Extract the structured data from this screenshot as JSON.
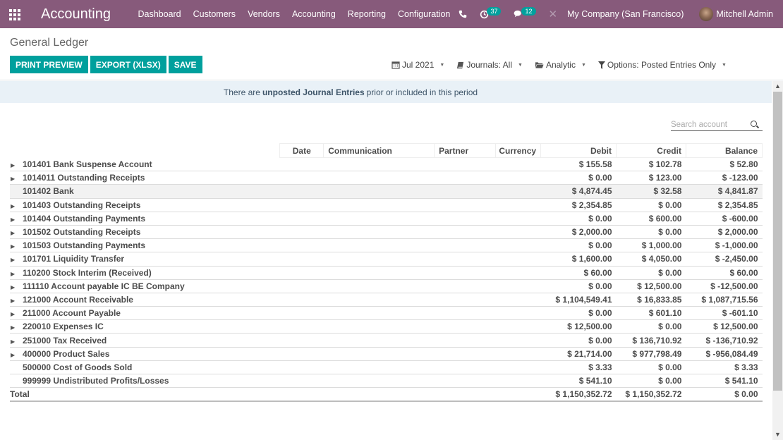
{
  "navbar": {
    "app_title": "Accounting",
    "menu": [
      "Dashboard",
      "Customers",
      "Vendors",
      "Accounting",
      "Reporting",
      "Configuration"
    ],
    "activity_count": "37",
    "messages_count": "12",
    "company": "My Company (San Francisco)",
    "user": "Mitchell Admin"
  },
  "control_panel": {
    "title": "General Ledger",
    "buttons": {
      "print_preview": "PRINT PREVIEW",
      "export": "EXPORT (XLSX)",
      "save": "SAVE"
    },
    "filters": {
      "date": "Jul 2021",
      "journals": "Journals: All",
      "analytic": "Analytic",
      "options": "Options: Posted Entries Only"
    }
  },
  "alert": {
    "prefix": "There are",
    "bold": "unposted Journal Entries",
    "suffix": "prior or included in this period"
  },
  "search": {
    "placeholder": "Search account"
  },
  "table": {
    "headers": [
      "Date",
      "Communication",
      "Partner",
      "Currency",
      "Debit",
      "Credit",
      "Balance"
    ],
    "rows": [
      {
        "expandable": true,
        "account": "101401 Bank Suspense Account",
        "debit": "$ 155.58",
        "credit": "$ 102.78",
        "balance": "$ 52.80"
      },
      {
        "expandable": true,
        "account": "1014011 Outstanding Receipts",
        "debit": "$ 0.00",
        "credit": "$ 123.00",
        "balance": "$ -123.00"
      },
      {
        "expandable": false,
        "account": "101402 Bank",
        "debit": "$ 4,874.45",
        "credit": "$ 32.58",
        "balance": "$ 4,841.87"
      },
      {
        "expandable": true,
        "account": "101403 Outstanding Receipts",
        "debit": "$ 2,354.85",
        "credit": "$ 0.00",
        "balance": "$ 2,354.85"
      },
      {
        "expandable": true,
        "account": "101404 Outstanding Payments",
        "debit": "$ 0.00",
        "credit": "$ 600.00",
        "balance": "$ -600.00"
      },
      {
        "expandable": true,
        "account": "101502 Outstanding Receipts",
        "debit": "$ 2,000.00",
        "credit": "$ 0.00",
        "balance": "$ 2,000.00"
      },
      {
        "expandable": true,
        "account": "101503 Outstanding Payments",
        "debit": "$ 0.00",
        "credit": "$ 1,000.00",
        "balance": "$ -1,000.00"
      },
      {
        "expandable": true,
        "account": "101701 Liquidity Transfer",
        "debit": "$ 1,600.00",
        "credit": "$ 4,050.00",
        "balance": "$ -2,450.00"
      },
      {
        "expandable": true,
        "account": "110200 Stock Interim (Received)",
        "debit": "$ 60.00",
        "credit": "$ 0.00",
        "balance": "$ 60.00"
      },
      {
        "expandable": true,
        "account": "111110 Account payable IC BE Company",
        "debit": "$ 0.00",
        "credit": "$ 12,500.00",
        "balance": "$ -12,500.00"
      },
      {
        "expandable": true,
        "account": "121000 Account Receivable",
        "debit": "$ 1,104,549.41",
        "credit": "$ 16,833.85",
        "balance": "$ 1,087,715.56"
      },
      {
        "expandable": true,
        "account": "211000 Account Payable",
        "debit": "$ 0.00",
        "credit": "$ 601.10",
        "balance": "$ -601.10"
      },
      {
        "expandable": true,
        "account": "220010 Expenses IC",
        "debit": "$ 12,500.00",
        "credit": "$ 0.00",
        "balance": "$ 12,500.00"
      },
      {
        "expandable": true,
        "account": "251000 Tax Received",
        "debit": "$ 0.00",
        "credit": "$ 136,710.92",
        "balance": "$ -136,710.92"
      },
      {
        "expandable": true,
        "account": "400000 Product Sales",
        "debit": "$ 21,714.00",
        "credit": "$ 977,798.49",
        "balance": "$ -956,084.49"
      },
      {
        "expandable": false,
        "account": "500000 Cost of Goods Sold",
        "debit": "$ 3.33",
        "credit": "$ 0.00",
        "balance": "$ 3.33"
      },
      {
        "expandable": false,
        "account": "999999 Undistributed Profits/Losses",
        "debit": "$ 541.10",
        "credit": "$ 0.00",
        "balance": "$ 541.10"
      }
    ],
    "total": {
      "label": "Total",
      "debit": "$ 1,150,352.72",
      "credit": "$ 1,150,352.72",
      "balance": "$ 0.00"
    }
  }
}
